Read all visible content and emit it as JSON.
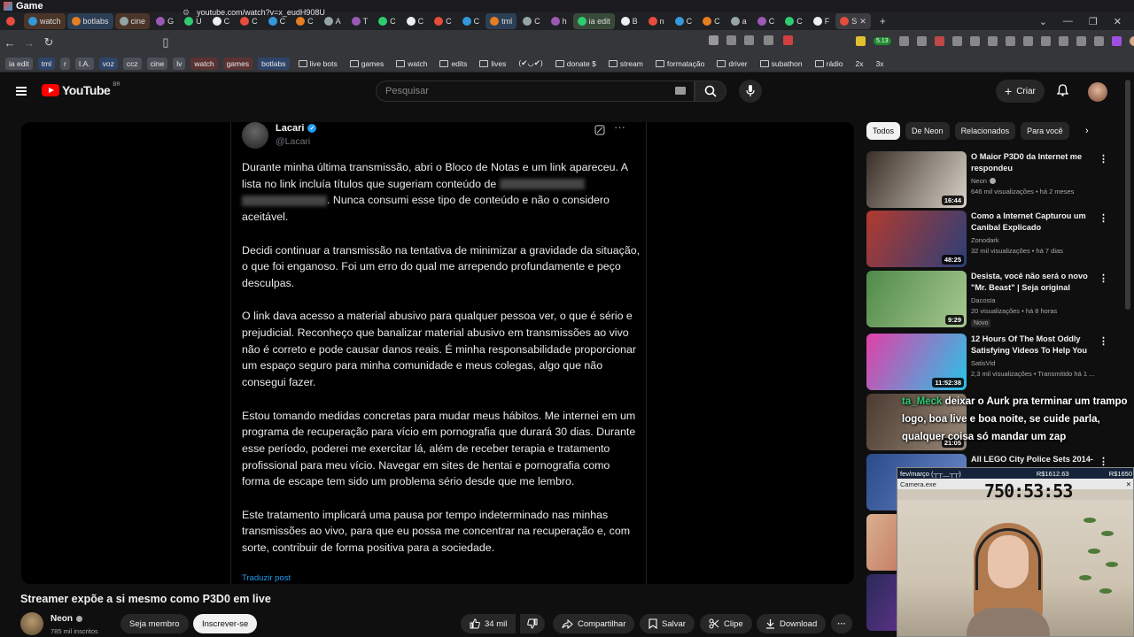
{
  "window": {
    "title": "Game"
  },
  "tabs": [
    {
      "label": "",
      "group": ""
    },
    {
      "label": "watch",
      "group": "g3"
    },
    {
      "label": "botlabs",
      "group": "g2"
    },
    {
      "label": "cine",
      "group": "g3"
    },
    {
      "label": "G",
      "group": ""
    },
    {
      "label": "U",
      "group": ""
    },
    {
      "label": "C",
      "group": ""
    },
    {
      "label": "C",
      "group": ""
    },
    {
      "label": "C",
      "group": ""
    },
    {
      "label": "C",
      "group": ""
    },
    {
      "label": "A",
      "group": ""
    },
    {
      "label": "T",
      "group": ""
    },
    {
      "label": "C",
      "group": ""
    },
    {
      "label": "C",
      "group": ""
    },
    {
      "label": "C",
      "group": ""
    },
    {
      "label": "C",
      "group": ""
    },
    {
      "label": "tml",
      "group": "g2"
    },
    {
      "label": "C",
      "group": ""
    },
    {
      "label": "h",
      "group": ""
    },
    {
      "label": "ia edit",
      "group": "g1"
    },
    {
      "label": "B",
      "group": ""
    },
    {
      "label": "n",
      "group": ""
    },
    {
      "label": "C",
      "group": ""
    },
    {
      "label": "C",
      "group": ""
    },
    {
      "label": "a",
      "group": ""
    },
    {
      "label": "C",
      "group": ""
    },
    {
      "label": "C",
      "group": ""
    },
    {
      "label": "F",
      "group": ""
    },
    {
      "label": "S",
      "group": "active"
    }
  ],
  "address": {
    "url": "youtube.com/watch?v=x_eudH908U"
  },
  "bookmarks": [
    {
      "label": "ia edit",
      "style": "chip"
    },
    {
      "label": "tml",
      "style": "c-blue"
    },
    {
      "label": "r",
      "style": "chip"
    },
    {
      "label": "I.A.",
      "style": "chip"
    },
    {
      "label": "voz",
      "style": "c-blue"
    },
    {
      "label": "ccz",
      "style": "chip"
    },
    {
      "label": "cine",
      "style": "chip"
    },
    {
      "label": "lv",
      "style": "chip"
    },
    {
      "label": "watch",
      "style": "c-red"
    },
    {
      "label": "games",
      "style": "c-red"
    },
    {
      "label": "botlabs",
      "style": "c-blue"
    },
    {
      "label": "live bots",
      "style": "folder"
    },
    {
      "label": "games",
      "style": "folder"
    },
    {
      "label": "watch",
      "style": "folder"
    },
    {
      "label": "edits",
      "style": "folder"
    },
    {
      "label": "lives",
      "style": "folder"
    },
    {
      "label": "(✔◡✔)",
      "style": "plain"
    },
    {
      "label": "donate $",
      "style": "folder"
    },
    {
      "label": "stream",
      "style": "folder"
    },
    {
      "label": "formatação",
      "style": "folder"
    },
    {
      "label": "driver",
      "style": "folder"
    },
    {
      "label": "subathon",
      "style": "folder"
    },
    {
      "label": "rádio",
      "style": "folder"
    },
    {
      "label": "2x",
      "style": "plain"
    },
    {
      "label": "3x",
      "style": "plain"
    }
  ],
  "ext_badge": "5.13",
  "youtube": {
    "logo": "YouTube",
    "region": "BR",
    "search_placeholder": "Pesquisar",
    "create_label": "Criar"
  },
  "tweet": {
    "name": "Lacari",
    "handle": "@Lacari",
    "paragraphs": [
      {
        "pre": "Durante minha última transmissão, abri o Bloco de Notas e um link apareceu. A lista no link incluía títulos que sugeriam conteúdo de",
        "post": ". Nunca consumi esse tipo de conteúdo e não o considero aceitável."
      },
      {
        "pre": "Decidi continuar a transmissão na tentativa de minimizar a gravidade da situação, o que foi enganoso. Foi um erro do qual me arrependo profundamente e peço desculpas.",
        "post": ""
      },
      {
        "pre": "O link dava acesso a material abusivo para qualquer pessoa ver, o que é sério e prejudicial. Reconheço que banalizar material abusivo em transmissões ao vivo não é correto e pode causar danos reais. É minha responsabilidade proporcionar um espaço seguro para minha comunidade e meus colegas, algo que não consegui fazer.",
        "post": ""
      },
      {
        "pre": "Estou tomando medidas concretas para mudar meus hábitos. Me internei em um programa de recuperação para vício em pornografia que durará 30 dias. Durante esse período, poderei me exercitar lá, além de receber terapia e tratamento profissional para meu vício. Navegar em sites de hentai e pornografia como forma de escape tem sido um problema sério desde que me lembro.",
        "post": ""
      },
      {
        "pre": "Este tratamento implicará uma pausa por tempo indeterminado nas minhas transmissões ao vivo, para que eu possa me concentrar na recuperação e, com sorte, contribuir de forma positiva para a sociedade.",
        "post": ""
      }
    ],
    "translate": "Traduzir post"
  },
  "video": {
    "title": "Streamer expõe a si mesmo como P3D0 em live",
    "channel": "Neon",
    "subs": "785 mil inscritos",
    "join": "Seja membro",
    "subscribe": "Inscrever-se",
    "likes": "34 mil",
    "share": "Compartilhar",
    "save": "Salvar",
    "clip": "Clipe",
    "download": "Download"
  },
  "chips": [
    "Todos",
    "De Neon",
    "Relacionados",
    "Para você"
  ],
  "recommendations": [
    {
      "title": "O Maior P3D0 da Internet me respondeu",
      "channel": "Neon",
      "verified": true,
      "meta": "646 mil visualizações • há 2 meses",
      "duration": "16:44",
      "badge": "",
      "colors": [
        "#3a2f28",
        "#d9d2c8"
      ]
    },
    {
      "title": "Como a Internet Capturou um Canibal Explicado",
      "channel": "Zonodark",
      "verified": false,
      "meta": "32 mil visualizações • há 7 dias",
      "duration": "48:25",
      "badge": "",
      "colors": [
        "#b23a2e",
        "#2b3f7a"
      ]
    },
    {
      "title": "Desista, você não será o novo \"Mr. Beast\" | Seja original",
      "channel": "Dacosta",
      "verified": false,
      "meta": "20 visualizações • há 8 horas",
      "duration": "9:29",
      "badge": "Novo",
      "colors": [
        "#4f8a4a",
        "#a8c98f"
      ]
    },
    {
      "title": "12 Hours Of The Most Oddly Satisfying Videos To Help You ...",
      "channel": "SatisVid",
      "verified": false,
      "meta": "2,3 mil visualizações • Transmitido há 1 ...",
      "duration": "11:52:38",
      "badge": "",
      "colors": [
        "#e23fa8",
        "#27c4e8"
      ]
    },
    {
      "title": "",
      "channel": "",
      "verified": false,
      "meta": "",
      "duration": "21:05",
      "badge": "",
      "colors": [
        "#4a3a30",
        "#9a8a7a"
      ]
    },
    {
      "title": "All LEGO City Police Sets 2014-",
      "channel": "",
      "verified": false,
      "meta": "",
      "duration": "",
      "badge": "",
      "colors": [
        "#2a4a8a",
        "#6a8acb"
      ]
    },
    {
      "title": "",
      "channel": "",
      "verified": false,
      "meta": "",
      "duration": "",
      "badge": "",
      "colors": [
        "#d9b090",
        "#b34a3a"
      ]
    },
    {
      "title": "",
      "channel": "",
      "verified": false,
      "meta": "",
      "duration": "",
      "badge": "",
      "colors": [
        "#2a2a5a",
        "#8a3ab0"
      ]
    }
  ],
  "chat": {
    "user": "ta_Meck",
    "message": "deixar o Aurk pra terminar um trampo logo, boa live e boa noite, se cuide parla, qualquer coisa só mandar um zap"
  },
  "cam": {
    "top_left": "fev/março (┬┬﹏┬┬)",
    "top_mid": "R$1612.63",
    "top_right": "R$1650",
    "window_title": "Camera.exe",
    "timer": "750:53:53"
  }
}
